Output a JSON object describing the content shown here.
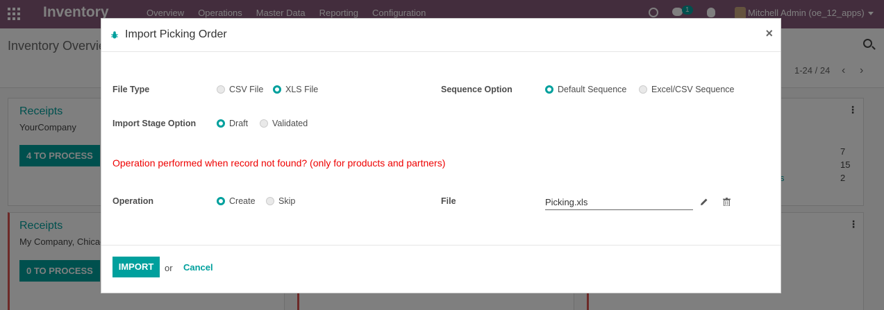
{
  "topbar": {
    "app_name": "Inventory",
    "menu": [
      "Overview",
      "Operations",
      "Master Data",
      "Reporting",
      "Configuration"
    ],
    "chat_badge": "1",
    "user_name": "Mitchell Admin (oe_12_apps)"
  },
  "control_panel": {
    "breadcrumb": "Inventory Overview",
    "pager": "1-24 / 24",
    "pager_prev": "‹",
    "pager_next": "›"
  },
  "cards": [
    {
      "title": "Receipts",
      "company": "YourCompany",
      "button": "4 TO PROCESS"
    },
    {
      "title": "Receipts",
      "company": "My Company, Chicago",
      "button": "0 TO PROCESS"
    }
  ],
  "right_card": {
    "numbers": [
      "7",
      "15",
      "2"
    ],
    "fragment": "s"
  },
  "kebab": "⋮",
  "modal": {
    "title": "Import Picking Order",
    "close": "×",
    "file_type": {
      "label": "File Type",
      "options": [
        "CSV File",
        "XLS File"
      ],
      "selected": "XLS File"
    },
    "sequence_option": {
      "label": "Sequence Option",
      "options": [
        "Default Sequence",
        "Excel/CSV Sequence"
      ],
      "selected": "Default Sequence"
    },
    "import_stage": {
      "label": "Import Stage Option",
      "options": [
        "Draft",
        "Validated"
      ],
      "selected": "Draft"
    },
    "warning": "Operation performed when record not found? (only for products and partners)",
    "operation": {
      "label": "Operation",
      "options": [
        "Create",
        "Skip"
      ],
      "selected": "Create"
    },
    "file": {
      "label": "File",
      "value": "Picking.xls"
    },
    "footer": {
      "import_label": "IMPORT",
      "or_label": "or",
      "cancel_label": "Cancel"
    }
  },
  "colors": {
    "brand": "#875a7b",
    "accent": "#00a09d",
    "warning": "#ee0000"
  }
}
